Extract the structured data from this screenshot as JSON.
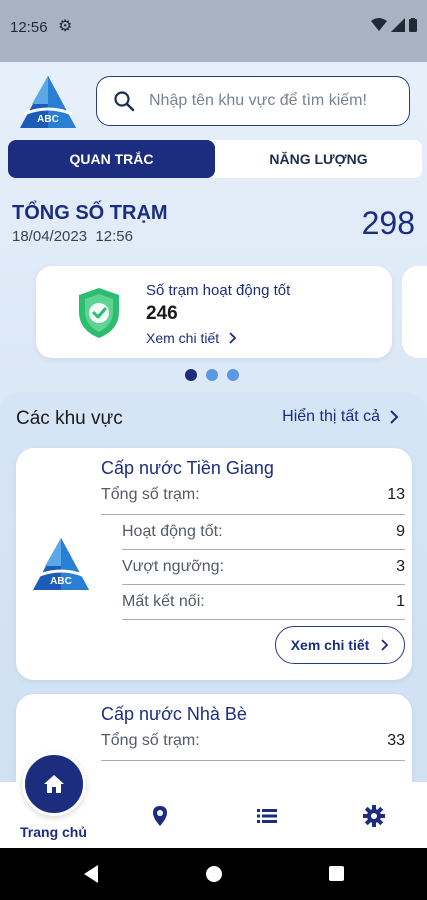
{
  "status_bar": {
    "time": "12:56"
  },
  "search": {
    "placeholder": "Nhập tên khu vực để tìm kiếm!"
  },
  "logo": {
    "text": "ABC"
  },
  "tabs": [
    {
      "label": "QUAN TRẮC",
      "active": true
    },
    {
      "label": "NĂNG LƯỢNG",
      "active": false
    }
  ],
  "summary": {
    "title": "TỔNG SỐ TRẠM",
    "date": "18/04/2023",
    "time": "12:56",
    "total": "298"
  },
  "stat_card": {
    "label": "Số trạm hoạt động tốt",
    "value": "246",
    "link": "Xem chi tiết"
  },
  "carousel": {
    "pages": 3,
    "active": 0
  },
  "areas": {
    "title": "Các khu vực",
    "view_all": "Hiển thị tất cả",
    "items": [
      {
        "name": "Cấp nước Tiền Giang",
        "total_label": "Tổng số trạm:",
        "total": "13",
        "rows": [
          {
            "label": "Hoạt động tốt:",
            "value": "9"
          },
          {
            "label": "Vượt ngưỡng:",
            "value": "3"
          },
          {
            "label": "Mất kết nối:",
            "value": "1"
          }
        ],
        "detail_label": "Xem chi tiết"
      },
      {
        "name": "Cấp nước Nhà Bè",
        "total_label": "Tổng số trạm:",
        "total": "33"
      }
    ]
  },
  "bottom_nav": {
    "home_label": "Trang chủ",
    "items": [
      "home-icon",
      "location-pin-icon",
      "list-icon",
      "settings-gear-icon"
    ]
  },
  "colors": {
    "primary": "#1c2d80",
    "accent_green": "#2dbd6e",
    "dot_inactive": "#5b97e3",
    "background": "#dfe9f5"
  }
}
